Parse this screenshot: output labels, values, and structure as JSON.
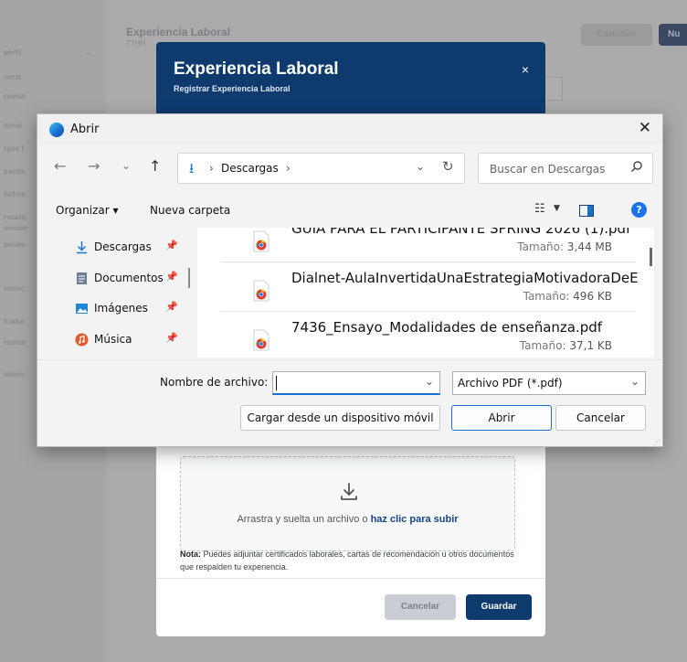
{
  "background": {
    "sidebar_items": [
      "perfil",
      "neral",
      "rsonal",
      "torial",
      "rgos f",
      "pacita",
      "tudios",
      "rmado",
      "encion",
      "perien",
      "istenc",
      "trador",
      "rsonal",
      "istenc"
    ],
    "page_title": "Experiencia Laboral",
    "page_subtitle": "TTHH",
    "cancel_label": "Cancelar",
    "new_label": "Nu"
  },
  "modal": {
    "title": "Experiencia Laboral",
    "subtitle": "Registrar Experiencia Laboral",
    "close_glyph": "×",
    "upload_text_prefix": "Arrastra y suelta un archivo o ",
    "upload_link": "haz clic para subir",
    "note_label": "Nota:",
    "note_text": " Puedes adjuntar certificados laborales, cartas de recomendación u otros documentos que respalden tu experiencia.",
    "cancel_label": "Cancelar",
    "save_label": "Guardar",
    "colors": {
      "header": "#0f3a6d",
      "primary": "#0f3a6d",
      "link": "#14468a"
    }
  },
  "dialog": {
    "title": "Abrir",
    "close_glyph": "✕",
    "address": {
      "location": "Descargas",
      "sep": "›"
    },
    "search_placeholder": "Buscar en Descargas",
    "commands": {
      "organize": "Organizar ▾",
      "new_folder": "Nueva carpeta"
    },
    "nav_items": [
      {
        "label": "Descargas",
        "icon": "download-icon"
      },
      {
        "label": "Documentos",
        "icon": "documents-icon"
      },
      {
        "label": "Imágenes",
        "icon": "pictures-icon"
      },
      {
        "label": "Música",
        "icon": "music-icon"
      }
    ],
    "size_label": "Tamaño:",
    "files": [
      {
        "name": "GUIA PARA EL PARTICIPANTE SPRING 2026 (1).pdf",
        "size": "3,44 MB"
      },
      {
        "name": "Dialnet-AulaInvertidaUnaEstrategiaMotivadoraDeE...",
        "size": "496 KB"
      },
      {
        "name": "7436_Ensayo_Modalidades de enseñanza.pdf",
        "size": "37,1 KB"
      }
    ],
    "filename_label": "Nombre de archivo:",
    "filename_value": "",
    "filetype": "Archivo PDF (*.pdf)",
    "btn_mobile": "Cargar desde un dispositivo móvil",
    "btn_open": "Abrir",
    "btn_cancel": "Cancelar",
    "help_glyph": "?",
    "colors": {
      "accent": "#1a6fd1"
    }
  }
}
